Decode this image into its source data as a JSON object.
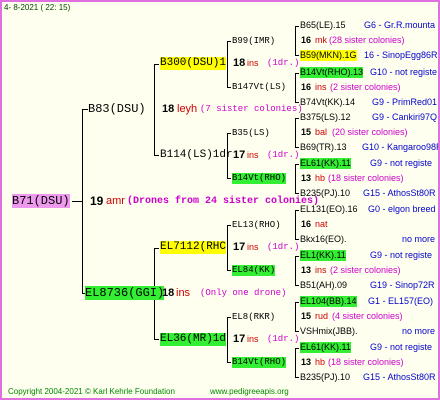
{
  "header": {
    "date": "4-  8-2021  ( 22: 15)"
  },
  "root": {
    "name": "B71(DSU)",
    "num": "19",
    "code": "amr",
    "note": "(Drones from 24 sister colonies)"
  },
  "sire": {
    "name": "B83(DSU)",
    "num": "18",
    "code": "leyh",
    "note": "(7 sister colonies)"
  },
  "sire_sire": {
    "name": "B300(DSU)1",
    "num": "18",
    "code": "ins",
    "note": "(1dr.)"
  },
  "sire_dam": {
    "name": "B114(LS)1dr",
    "num": "17",
    "code": "ins",
    "note": "(1dr.)"
  },
  "dam": {
    "name": "EL8736(GGI)",
    "num": "18",
    "code": "ins",
    "note": "(Only one drone)"
  },
  "dam_sire": {
    "name": "EL7112(RHC",
    "num": "17",
    "code": "ins",
    "note": "(1dr.)"
  },
  "dam_dam": {
    "name": "EL36(MR)1d",
    "num": "17",
    "code": "ins",
    "note": "(1dr.)"
  },
  "g3": [
    {
      "name": "B99(IMR)"
    },
    {
      "name": "B147Vt(LS)"
    },
    {
      "name": "B35(LS)"
    },
    {
      "name": "B14Vt(RHO)"
    },
    {
      "name": "EL13(RHO)"
    },
    {
      "name": "EL84(KK)"
    },
    {
      "name": "EL8(RKR)"
    },
    {
      "name": "B14Vt(RHO)"
    }
  ],
  "g4": [
    {
      "l": "B65(LE).15",
      "r": "G6 - Gr.R.mounta"
    },
    {
      "num": "16",
      "code": "mk",
      "note": "(28 sister colonies)"
    },
    {
      "l": "B59(MKN).1G",
      "r": "16 - SinopEgg86R"
    },
    {
      "l": "B14Vt(RHO).13",
      "r": "G10 - not registe"
    },
    {
      "num": "16",
      "code": "ins",
      "note": "(2 sister colonies)"
    },
    {
      "l": "B74Vt(KK).14",
      "r": "G9 - PrimRed01"
    },
    {
      "l": "B375(LS).12",
      "r": "G9 - Cankiri97Q"
    },
    {
      "num": "15",
      "code": "bal",
      "note": "(20 sister colonies)"
    },
    {
      "l": "B69(TR).13",
      "r": "G10 - Kangaroo98R"
    },
    {
      "l": "EL61(KK).11",
      "r": "G9 - not registe"
    },
    {
      "num": "13",
      "code": "hb",
      "note": "(18 sister colonies)"
    },
    {
      "l": "B235(PJ).10",
      "r": "G15 - AthosSt80R"
    },
    {
      "l": "EL131(EO).16",
      "r": "G0 - elgon breed"
    },
    {
      "num": "16",
      "code": "nat",
      "note": ""
    },
    {
      "l": "Bkx16(EO).",
      "r": "no more"
    },
    {
      "l": "EL1(KK).11",
      "r": "G9 - not registe"
    },
    {
      "num": "13",
      "code": "ins",
      "note": "(2 sister colonies)"
    },
    {
      "l": "B51(AH).09",
      "r": "G19 - Sinop72R"
    },
    {
      "l": "EL104(BB).14",
      "r": "G1 - EL157(EO)"
    },
    {
      "num": "15",
      "code": "rud",
      "note": "(4 sister colonies)"
    },
    {
      "l": "VSHmix(JBB).",
      "r": "no more"
    },
    {
      "l": "EL61(KK).11",
      "r": "G9 - not registe"
    },
    {
      "num": "13",
      "code": "hb",
      "note": "(18 sister colonies)"
    },
    {
      "l": "B235(PJ).10",
      "r": "G15 - AthosSt80R"
    }
  ],
  "footer": {
    "copyright": "Copyright 2004-2021 © Karl Kehrle Foundation",
    "site": "www.pedigreeapis.org"
  }
}
